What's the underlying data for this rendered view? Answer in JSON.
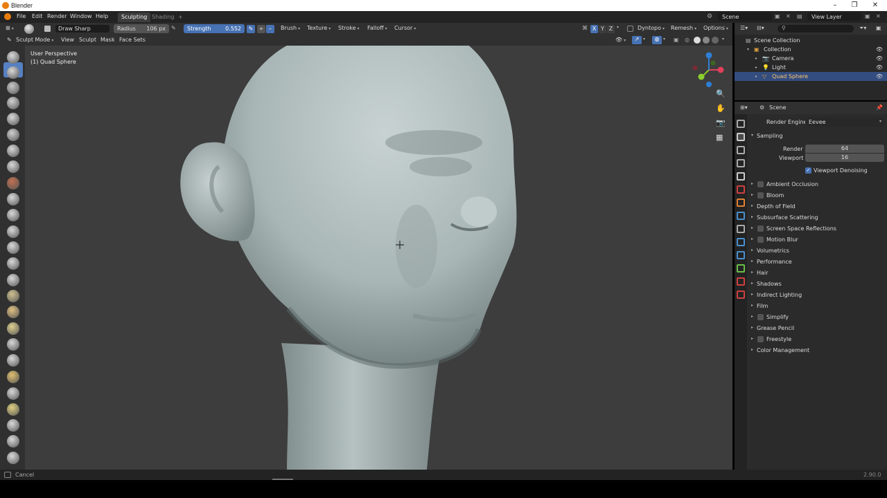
{
  "window": {
    "title": "Blender",
    "controls": [
      "–",
      "❐",
      "✕"
    ]
  },
  "menu": {
    "items": [
      "File",
      "Edit",
      "Render",
      "Window",
      "Help"
    ],
    "workspaces": {
      "active": "Sculpting",
      "inactive": "Shading",
      "add": "+"
    },
    "scene": "Scene",
    "view_layer": "View Layer"
  },
  "tool_header": {
    "brush_name": "Draw Sharp",
    "radius_label": "Radius",
    "radius_value": "106 px",
    "strength_label": "Strength",
    "strength_value": "0.552",
    "minus": "–",
    "plus": "+",
    "menus": [
      "Brush",
      "Texture",
      "Stroke",
      "Falloff",
      "Cursor"
    ],
    "axis": [
      "X",
      "Y",
      "Z"
    ],
    "dyntopo": "Dyntopo",
    "remesh": "Remesh",
    "options": "Options"
  },
  "mode_header": {
    "mode": "Sculpt Mode",
    "menus": [
      "View",
      "Sculpt",
      "Mask",
      "Face Sets"
    ]
  },
  "viewport": {
    "perspective": "User Perspective",
    "object": "(1) Quad Sphere",
    "gizmo": {
      "x": "X",
      "y": "Y",
      "z": "Z"
    }
  },
  "outliner": {
    "root": "Scene Collection",
    "items": [
      {
        "label": "Collection",
        "indent": 1
      },
      {
        "label": "Camera",
        "indent": 2
      },
      {
        "label": "Light",
        "indent": 2
      },
      {
        "label": "Quad Sphere",
        "indent": 2,
        "selected": true
      }
    ]
  },
  "properties": {
    "context": "Scene",
    "render_engine_label": "Render Engine",
    "render_engine_value": "Eevee",
    "sampling": {
      "label": "Sampling",
      "render_label": "Render",
      "render_value": "64",
      "viewport_label": "Viewport",
      "viewport_value": "16",
      "denoise_label": "Viewport Denoising"
    },
    "panels": [
      {
        "label": "Ambient Occlusion",
        "checkbox": true
      },
      {
        "label": "Bloom",
        "checkbox": true
      },
      {
        "label": "Depth of Field",
        "checkbox": false
      },
      {
        "label": "Subsurface Scattering",
        "checkbox": false
      },
      {
        "label": "Screen Space Reflections",
        "checkbox": true
      },
      {
        "label": "Motion Blur",
        "checkbox": true
      },
      {
        "label": "Volumetrics",
        "checkbox": false
      },
      {
        "label": "Performance",
        "checkbox": false
      },
      {
        "label": "Hair",
        "checkbox": false
      },
      {
        "label": "Shadows",
        "checkbox": false
      },
      {
        "label": "Indirect Lighting",
        "checkbox": false
      },
      {
        "label": "Film",
        "checkbox": false
      },
      {
        "label": "Simplify",
        "checkbox": true
      },
      {
        "label": "Grease Pencil",
        "checkbox": false
      },
      {
        "label": "Freestyle",
        "checkbox": true
      },
      {
        "label": "Color Management",
        "checkbox": false
      }
    ]
  },
  "status": {
    "left": "Cancel",
    "version": "2.90.0"
  },
  "colors": {
    "accent": "#4772b3",
    "selected_row": "#334d80",
    "logo": "#e87d0d"
  }
}
